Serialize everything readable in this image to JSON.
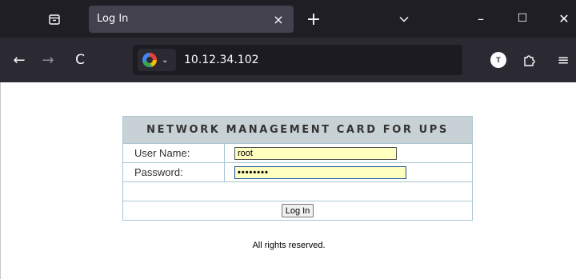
{
  "browser": {
    "tab_title": "Log In",
    "tab_close": "×",
    "new_tab": "+",
    "url": "10.12.34.102",
    "profile_initial": "T",
    "window": {
      "minimize": "–",
      "maximize": "☐",
      "close": "✕"
    },
    "nav": {
      "back": "←",
      "forward": "→",
      "reload": "C",
      "menu": "≡"
    }
  },
  "login": {
    "title": "NETWORK MANAGEMENT CARD FOR UPS",
    "username_label": "User Name:",
    "username_value": "root",
    "password_label": "Password:",
    "password_value": "••••••••",
    "submit_label": "Log In"
  },
  "footer": {
    "text": "All rights reserved."
  },
  "colors": {
    "header_bg": "#c8d1d6",
    "header_text": "#5f7886",
    "input_bg": "#ffffc0",
    "table_border": "#a9c6d2"
  }
}
